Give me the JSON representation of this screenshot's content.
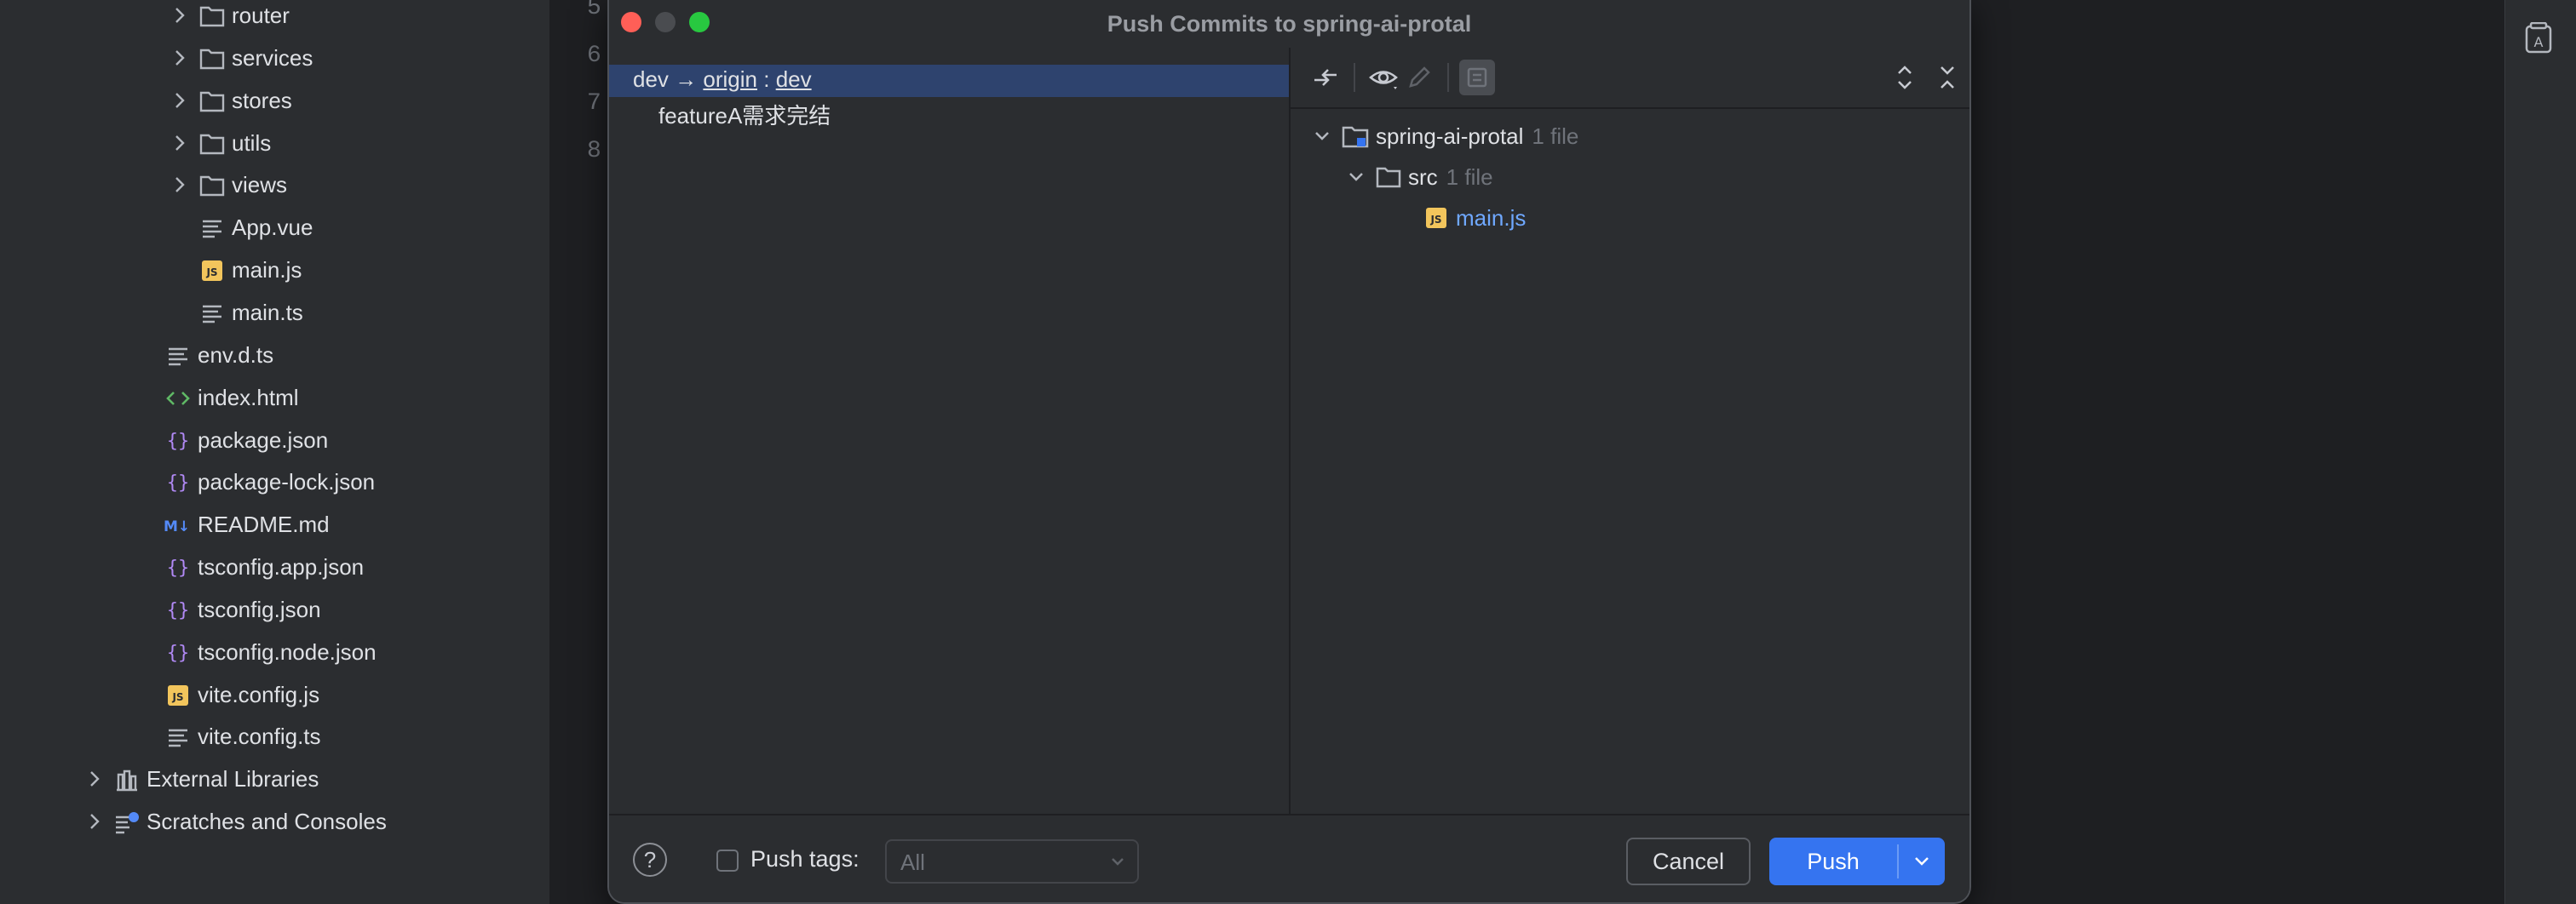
{
  "project_tree": [
    {
      "label": "router",
      "type": "folder",
      "depth": 2,
      "expandable": true
    },
    {
      "label": "services",
      "type": "folder",
      "depth": 2,
      "expandable": true
    },
    {
      "label": "stores",
      "type": "folder",
      "depth": 2,
      "expandable": true
    },
    {
      "label": "utils",
      "type": "folder",
      "depth": 2,
      "expandable": true
    },
    {
      "label": "views",
      "type": "folder",
      "depth": 2,
      "expandable": true
    },
    {
      "label": "App.vue",
      "type": "text",
      "depth": 2
    },
    {
      "label": "main.js",
      "type": "js",
      "depth": 2
    },
    {
      "label": "main.ts",
      "type": "text",
      "depth": 2
    },
    {
      "label": "env.d.ts",
      "type": "text",
      "depth": 1
    },
    {
      "label": "index.html",
      "type": "html",
      "depth": 1
    },
    {
      "label": "package.json",
      "type": "json",
      "depth": 1
    },
    {
      "label": "package-lock.json",
      "type": "json",
      "depth": 1
    },
    {
      "label": "README.md",
      "type": "md",
      "depth": 1
    },
    {
      "label": "tsconfig.app.json",
      "type": "json",
      "depth": 1
    },
    {
      "label": "tsconfig.json",
      "type": "json",
      "depth": 1
    },
    {
      "label": "tsconfig.node.json",
      "type": "json",
      "depth": 1
    },
    {
      "label": "vite.config.js",
      "type": "js",
      "depth": 1
    },
    {
      "label": "vite.config.ts",
      "type": "text",
      "depth": 1
    },
    {
      "label": "External Libraries",
      "type": "library",
      "depth": 0,
      "expandable": true
    },
    {
      "label": "Scratches and Consoles",
      "type": "scratch",
      "depth": 0,
      "expandable": true
    }
  ],
  "editor": {
    "line_numbers": [
      "5",
      "6",
      "7",
      "8"
    ]
  },
  "dialog": {
    "title": "Push Commits to spring-ai-protal",
    "branch_row": {
      "local": "dev",
      "arrow": "→",
      "remote": "origin",
      "colon": ":",
      "remote_branch": "dev"
    },
    "commit_message": "featureA需求完结",
    "changes_tree": {
      "root": {
        "label": "spring-ai-protal",
        "count": "1 file"
      },
      "folder": {
        "label": "src",
        "count": "1 file"
      },
      "file": {
        "label": "main.js"
      }
    },
    "footer": {
      "help_label": "?",
      "push_tags_label": "Push tags:",
      "push_tags_value": "All",
      "cancel_label": "Cancel",
      "push_label": "Push"
    }
  },
  "colors": {
    "accent": "#3574f0",
    "selection": "#2e436e",
    "close": "#ff5f57",
    "maximize": "#28c840",
    "js_badge": "#f2c55c",
    "json_icon": "#b189f5",
    "html_icon": "#5fb865"
  }
}
